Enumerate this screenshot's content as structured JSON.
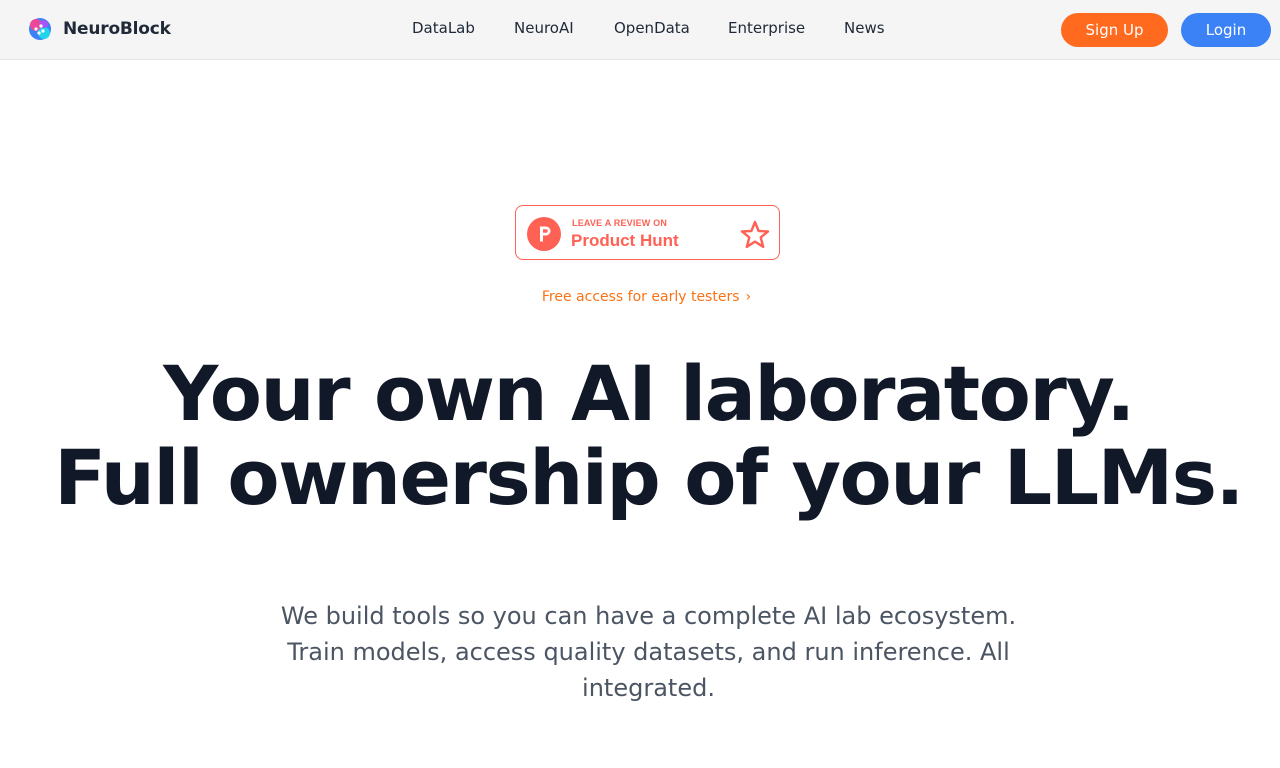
{
  "brand": {
    "name": "NeuroBlock",
    "logo_icon": "neuroblock-logo-icon"
  },
  "nav": {
    "links": [
      "DataLab",
      "NeuroAI",
      "OpenData",
      "Enterprise",
      "News"
    ]
  },
  "auth": {
    "signup_label": "Sign Up",
    "login_label": "Login"
  },
  "product_hunt": {
    "small_text": "LEAVE A REVIEW ON",
    "big_text": "Product Hunt",
    "icon": "product-hunt-icon",
    "star_icon": "star-icon"
  },
  "early_access": {
    "text": "Free access for early testers",
    "chevron_icon": "chevron-right-icon"
  },
  "hero": {
    "headline_line1": "Your own AI laboratory.",
    "headline_line2": "Full ownership of your LLMs.",
    "subtitle": "We build tools so you can have a complete AI lab ecosystem. Train models, access quality datasets, and run inference. All integrated."
  },
  "colors": {
    "signup_bg": "#ff6a1f",
    "login_bg": "#3b82f6",
    "product_hunt": "#ff6154",
    "early_access_text": "#f97316",
    "headline": "#111827",
    "subtitle": "#4b5563",
    "navbar_bg": "#f5f5f5"
  }
}
